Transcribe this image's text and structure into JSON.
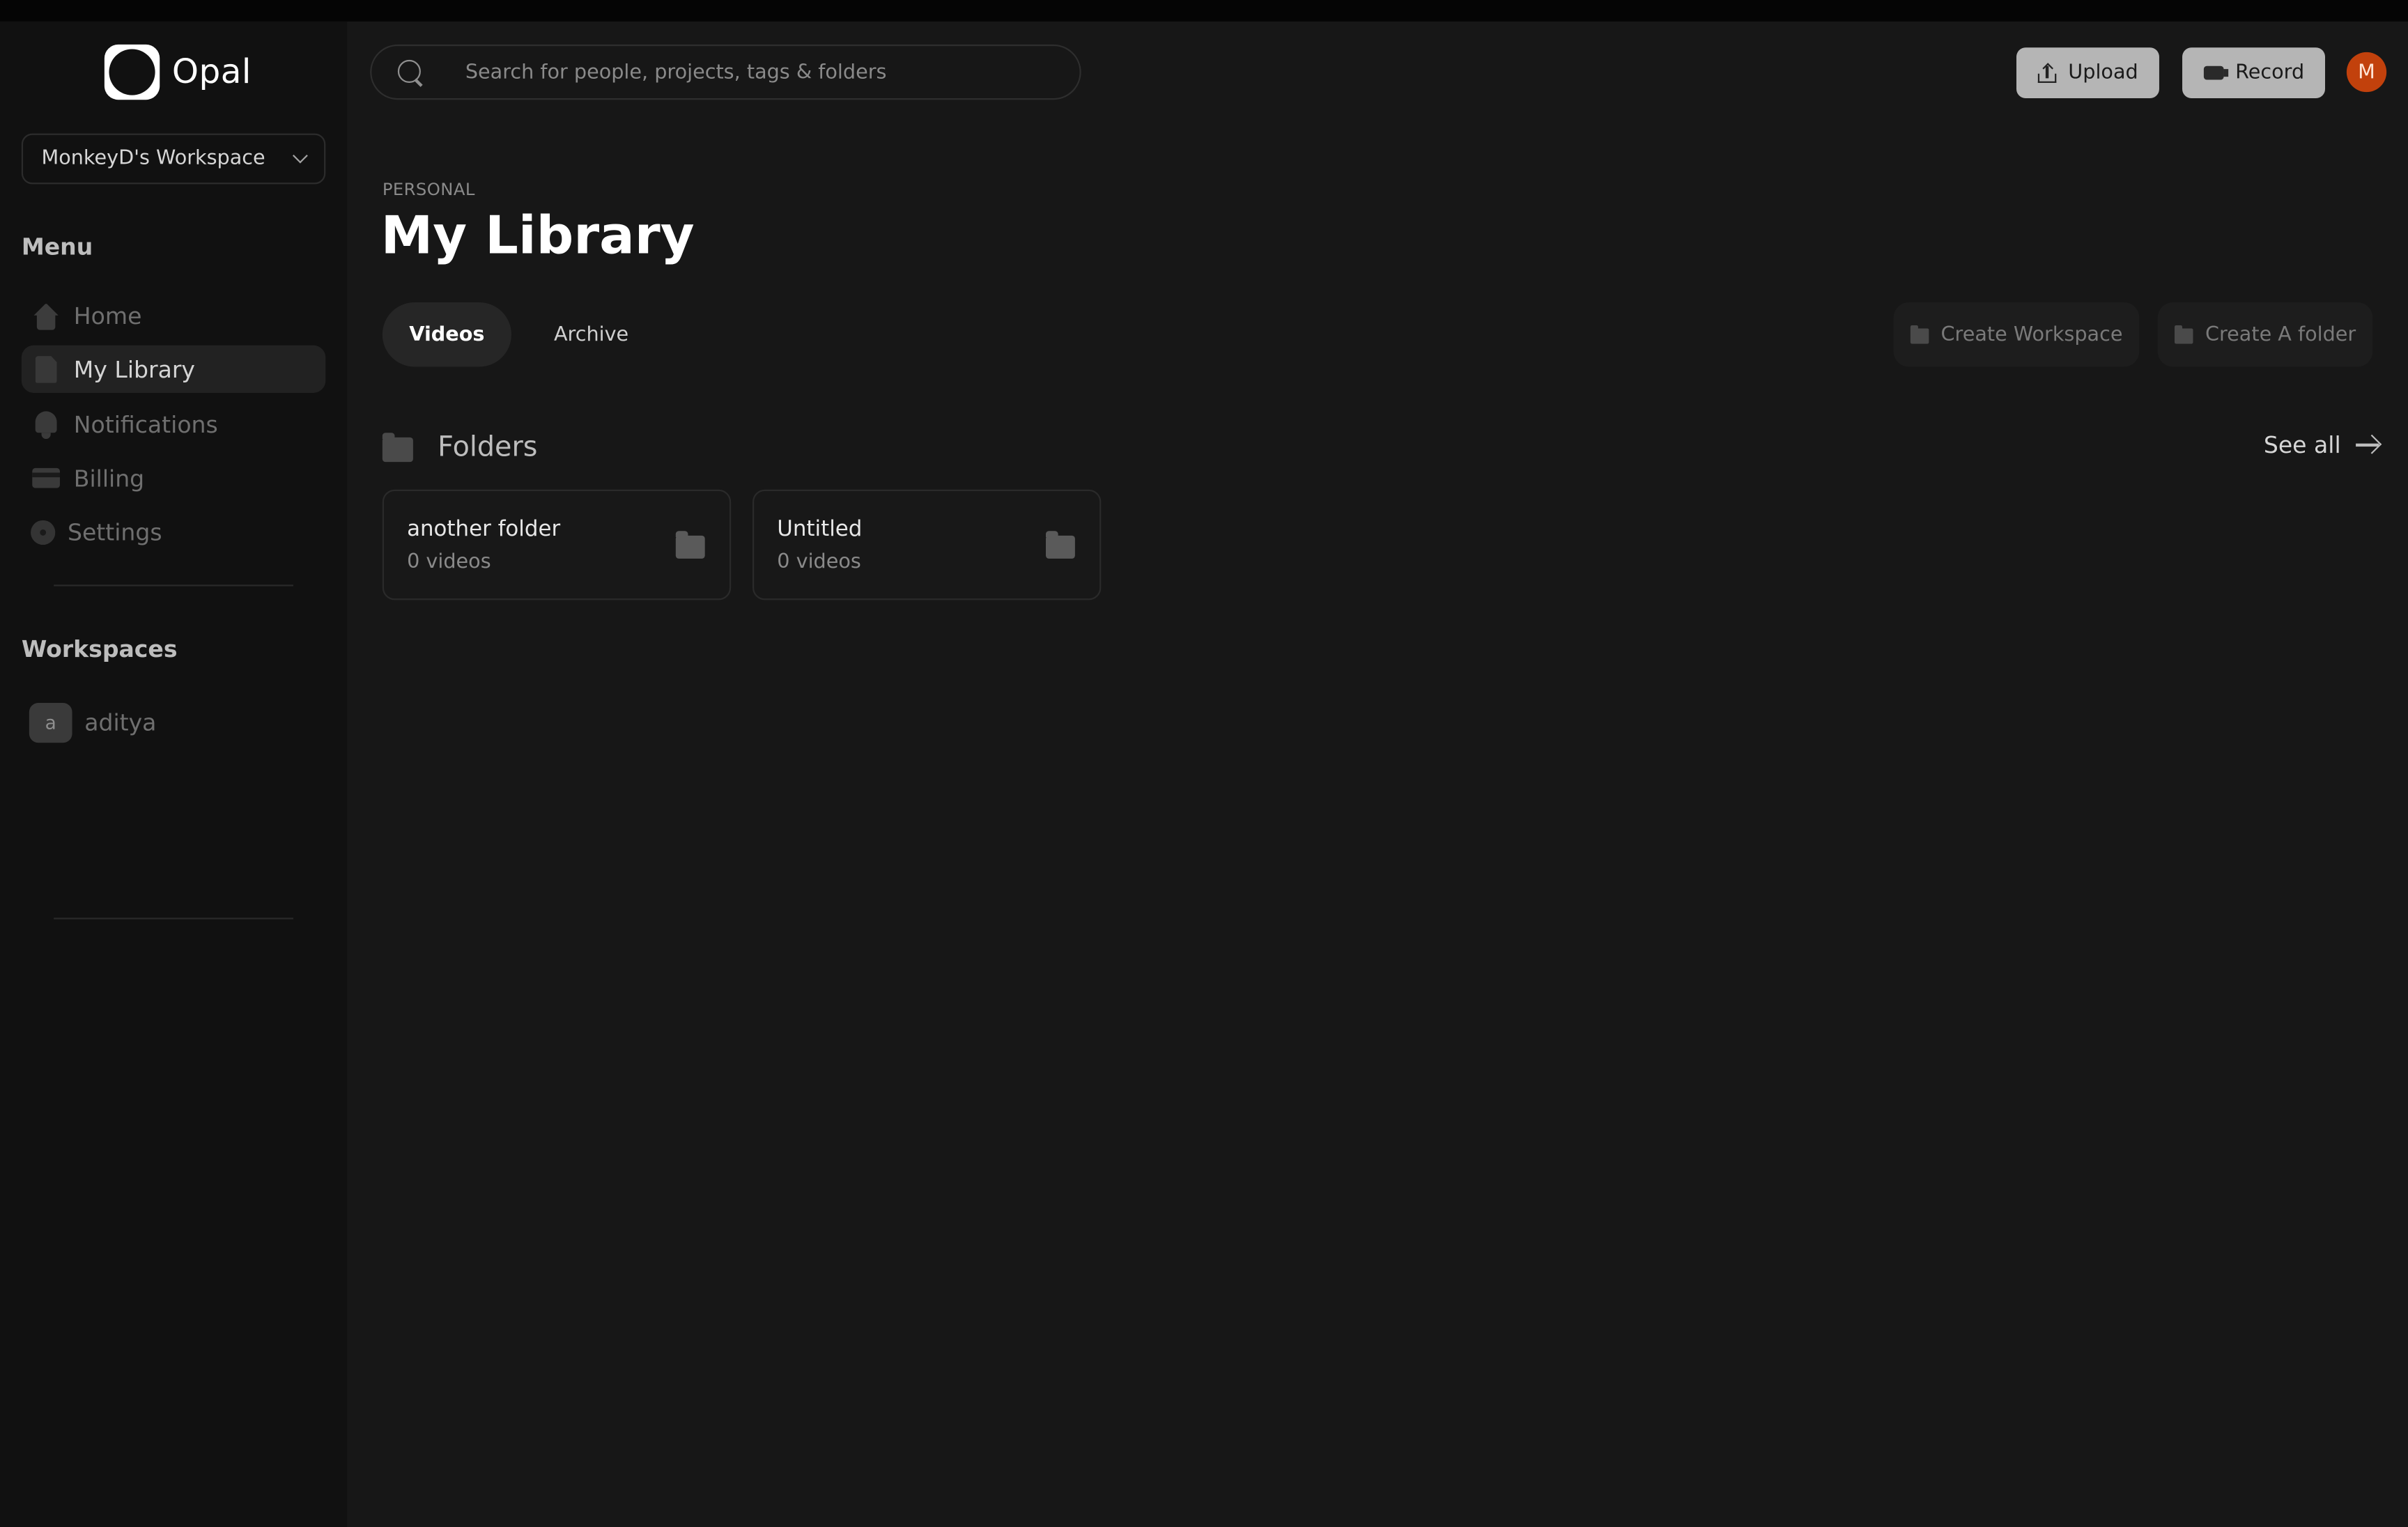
{
  "app": {
    "name": "Opal"
  },
  "workspace_selector": {
    "value": "MonkeyD's Workspace"
  },
  "sidebar": {
    "menu_title": "Menu",
    "items": [
      {
        "label": "Home",
        "icon": "home-icon"
      },
      {
        "label": "My Library",
        "icon": "document-icon",
        "active": true
      },
      {
        "label": "Notifications",
        "icon": "bell-icon"
      },
      {
        "label": "Billing",
        "icon": "credit-card-icon"
      },
      {
        "label": "Settings",
        "icon": "gear-icon"
      }
    ],
    "workspaces_title": "Workspaces",
    "workspaces": [
      {
        "initial": "a",
        "name": "aditya"
      }
    ]
  },
  "header": {
    "search": {
      "placeholder": "Search for people, projects, tags & folders",
      "value": ""
    },
    "upload_label": "Upload",
    "record_label": "Record",
    "avatar_initial": "M",
    "avatar_color": "#c2410c"
  },
  "main": {
    "eyebrow": "PERSONAL",
    "title": "My Library",
    "tabs": [
      {
        "label": "Videos",
        "active": true
      },
      {
        "label": "Archive",
        "active": false
      }
    ],
    "actions": {
      "create_workspace": "Create Workspace",
      "create_folder": "Create A folder"
    },
    "folders": {
      "title": "Folders",
      "see_all": "See all",
      "items": [
        {
          "name": "another folder",
          "count": "0 videos"
        },
        {
          "name": "Untitled",
          "count": "0 videos"
        }
      ]
    }
  }
}
